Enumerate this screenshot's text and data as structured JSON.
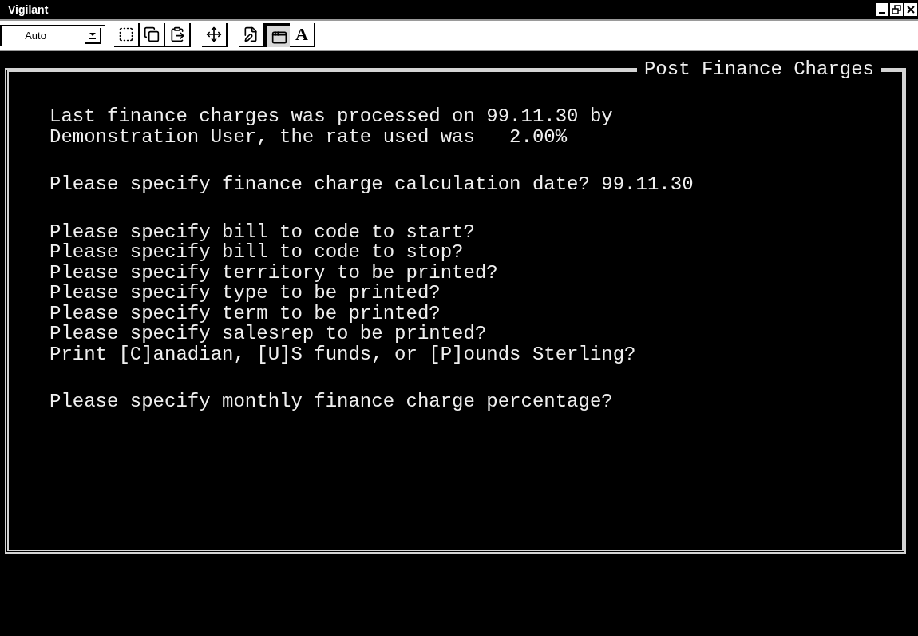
{
  "window": {
    "title": "Vigilant"
  },
  "toolbar": {
    "zoom_select": {
      "value": "Auto"
    },
    "buttons": [
      {
        "pressed": false
      },
      {
        "pressed": false
      },
      {
        "pressed": false
      },
      {
        "pressed": false
      },
      {
        "pressed": false
      },
      {
        "pressed": true
      },
      {
        "pressed": false,
        "label": "A"
      }
    ]
  },
  "screen": {
    "title": "Post Finance Charges",
    "groups": [
      [
        "Last finance charges was processed on 99.11.30 by",
        "Demonstration User, the rate used was   2.00%"
      ],
      [
        "Please specify finance charge calculation date? 99.11.30"
      ],
      [
        "Please specify bill to code to start?",
        "Please specify bill to code to stop?",
        "Please specify territory to be printed?",
        "Please specify type to be printed?",
        "Please specify term to be printed?",
        "Please specify salesrep to be printed?",
        "Print [C]anadian, [U]S funds, or [P]ounds Sterling?"
      ],
      [
        "Please specify monthly finance charge percentage?"
      ]
    ]
  }
}
